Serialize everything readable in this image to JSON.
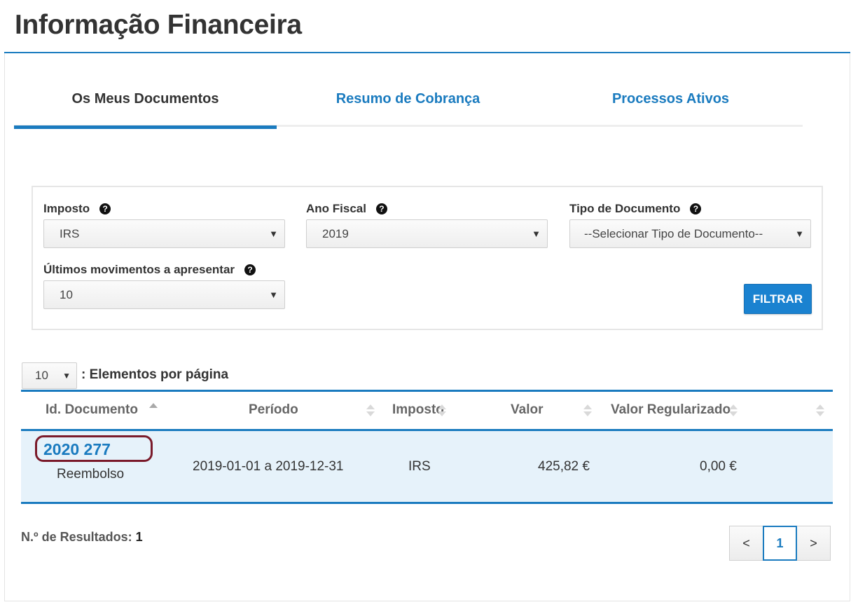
{
  "page": {
    "title": "Informação Financeira"
  },
  "tabs": [
    {
      "label": "Os Meus Documentos",
      "active": true
    },
    {
      "label": "Resumo de Cobrança",
      "active": false
    },
    {
      "label": "Processos Ativos",
      "active": false
    }
  ],
  "filters": {
    "imposto": {
      "label": "Imposto",
      "value": "IRS"
    },
    "ano_fiscal": {
      "label": "Ano Fiscal",
      "value": "2019"
    },
    "tipo_documento": {
      "label": "Tipo de Documento",
      "value": "--Selecionar Tipo de Documento--"
    },
    "ultimos_movimentos": {
      "label": "Últimos movimentos a apresentar",
      "value": "10"
    },
    "submit_label": "FILTRAR"
  },
  "icons": {
    "help": "question-circle-icon",
    "caret": "▼"
  },
  "per_page": {
    "value": "10",
    "label": ": Elementos por página"
  },
  "table": {
    "columns": [
      "Id. Documento",
      "Período",
      "Imposto",
      "Valor",
      "Valor Regularizado"
    ],
    "rows": [
      {
        "id": "2020 277",
        "type": "Reembolso",
        "periodo": "2019-01-01 a 2019-12-31",
        "imposto": "IRS",
        "valor": "425,82 €",
        "valor_regularizado": "0,00 €"
      }
    ]
  },
  "results": {
    "label": "N.º de Resultados:",
    "count": "1"
  },
  "pagination": {
    "prev": "<",
    "current": "1",
    "next": ">"
  },
  "colors": {
    "accent": "#1a7bbf",
    "button": "#1a82d0",
    "row_highlight": "#e6f2fa",
    "annotation_circle": "#7a1a2a"
  }
}
